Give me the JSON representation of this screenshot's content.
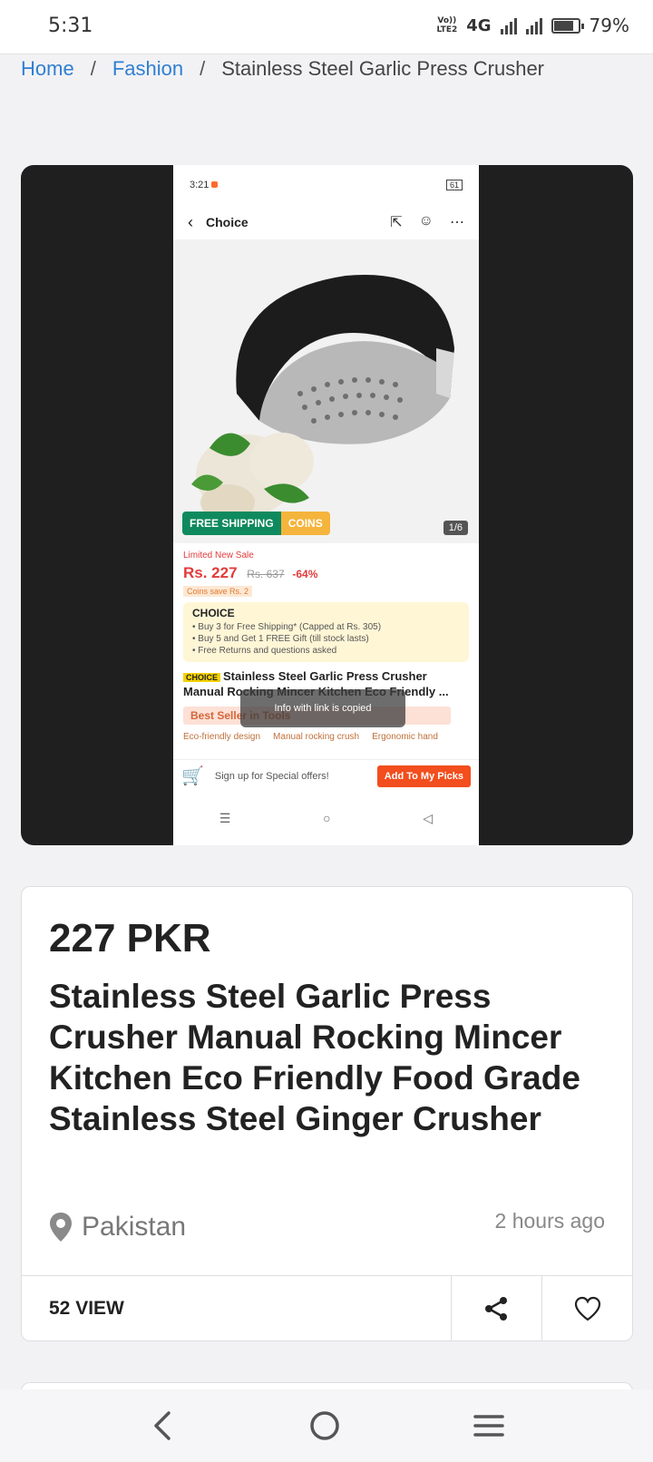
{
  "status_bar": {
    "time": "5:31",
    "volte_line1": "Vo))",
    "volte_line2": "LTE2",
    "network": "4G",
    "battery_percent": "79%",
    "battery_level": 0.79
  },
  "breadcrumb": {
    "items": [
      "Home",
      "Fashion"
    ],
    "separator": "/",
    "current": "Stainless Steel Garlic Press Crusher"
  },
  "screenshot": {
    "time": "3:21",
    "battery": "61",
    "header_title": "Choice",
    "free_shipping": "FREE SHIPPING",
    "coins": "COINS",
    "counter": "1/6",
    "sale_label": "Limited New Sale",
    "price": "Rs. 227",
    "old_price": "Rs. 637",
    "discount": "-64%",
    "coins_note": "Coins save Rs. 2",
    "choice_title": "CHOICE",
    "choice_lines": [
      "• Buy 3 for Free Shipping* (Capped at Rs. 305)",
      "• Buy 5 and Get 1 FREE Gift (till stock lasts)",
      "• Free Returns and questions asked"
    ],
    "name_tag": "CHOICE",
    "name": "Stainless Steel Garlic Press Crusher Manual Rocking Mincer Kitchen Eco Friendly ...",
    "best_seller": "Best Seller in Tools",
    "features": [
      "Eco-friendly design",
      "Manual rocking crush",
      "Ergonomic hand"
    ],
    "toast": "Info with link is copied",
    "signup": "Sign up for Special offers!",
    "add_button": "Add To My Picks",
    "nav": [
      "☰",
      "○",
      "◁"
    ]
  },
  "product": {
    "price": "227 PKR",
    "title": "Stainless Steel Garlic Press Crusher Manual Rocking Mincer Kitchen Eco Friendly Food Grade Stainless Steel Ginger Crusher",
    "location": "Pakistan",
    "posted": "2 hours ago",
    "views": "52 VIEW"
  },
  "icons": {
    "location": "map-pin-icon",
    "share": "share-icon",
    "favorite": "heart-icon",
    "back": "chevron-left-icon",
    "home": "circle-home-icon",
    "menu": "hamburger-menu-icon"
  },
  "colors": {
    "link": "#2f7fd1",
    "background": "#f2f2f5",
    "accent": "#f24e1e"
  }
}
